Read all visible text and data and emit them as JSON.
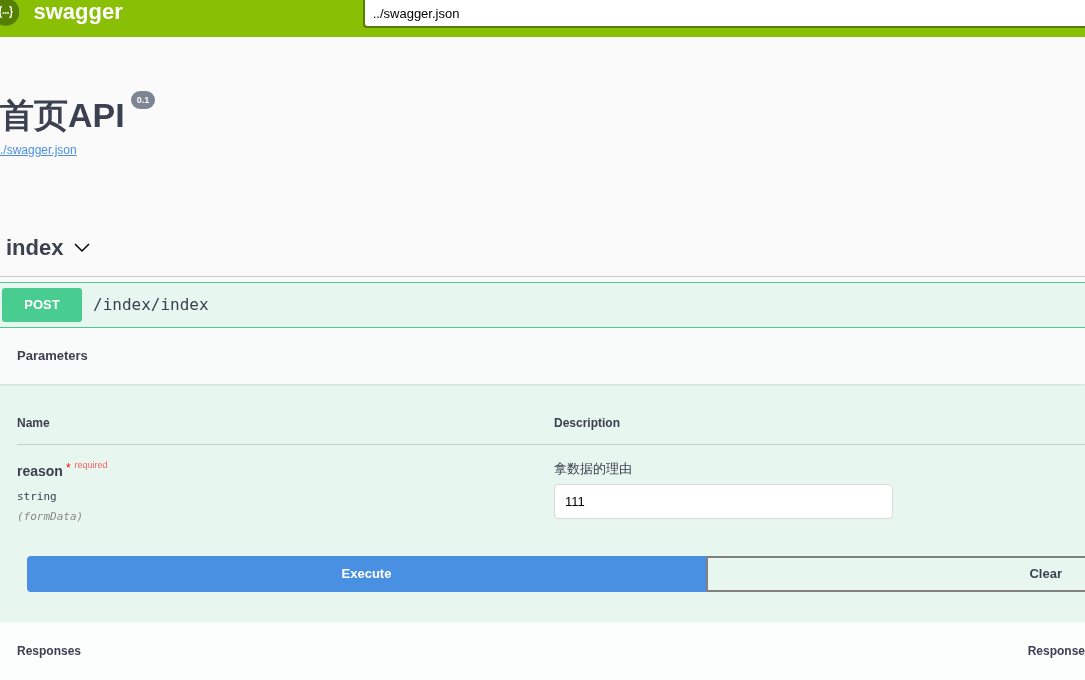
{
  "header": {
    "logo_text": "swagger",
    "url_field": {
      "value": "../swagger.json"
    }
  },
  "info": {
    "title": "首页API",
    "version": "0.1",
    "link": "./swagger.json"
  },
  "tag": {
    "name": "index",
    "expanded": true
  },
  "operation": {
    "method": "POST",
    "path": "/index/index",
    "parameters_title": "Parameters",
    "columns": [
      "Name",
      "Description"
    ],
    "parameters": [
      {
        "name": "reason",
        "required": true,
        "required_mark": "*",
        "required_label": "required",
        "type": "string",
        "in": "(formData)",
        "description": "拿数据的理由",
        "value": "111"
      }
    ],
    "buttons": [
      {
        "label": "Execute",
        "kind": "primary"
      },
      {
        "label": "Clear",
        "kind": "outline"
      }
    ],
    "responses_title": "Responses",
    "responses_column": "Response"
  }
}
